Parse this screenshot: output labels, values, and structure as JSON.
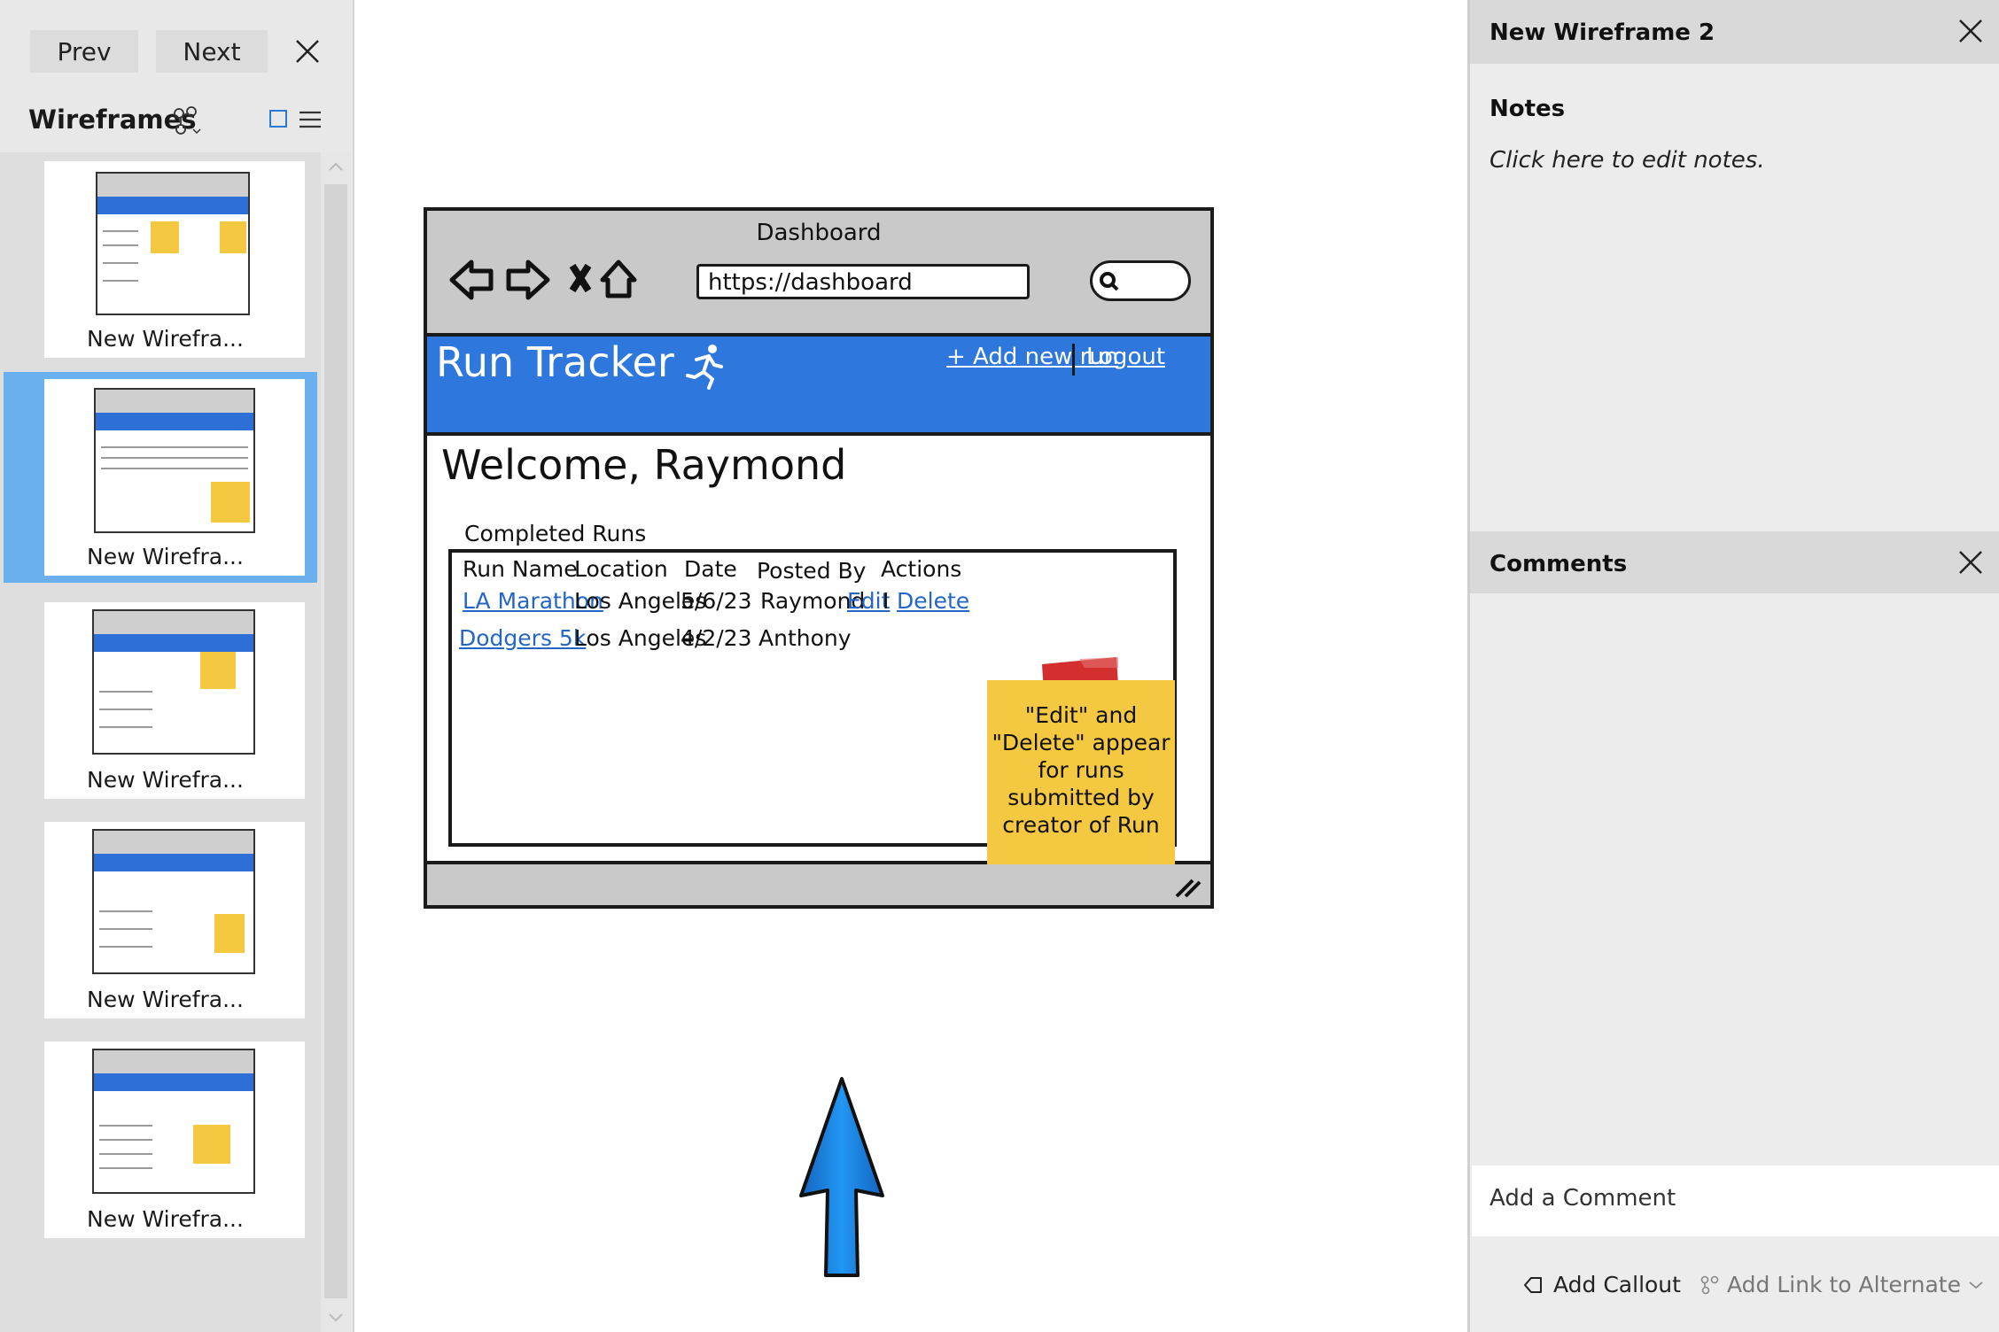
{
  "left_panel": {
    "prev_label": "Prev",
    "next_label": "Next",
    "title": "Wireframes",
    "thumbnails": [
      {
        "label": "New Wirefra...",
        "selected": false
      },
      {
        "label": "New Wirefra...",
        "selected": true
      },
      {
        "label": "New Wirefra...",
        "selected": false
      },
      {
        "label": "New Wirefra...",
        "selected": false
      },
      {
        "label": "New Wirefra...",
        "selected": false
      }
    ]
  },
  "mockup": {
    "browser_title": "Dashboard",
    "url": "https://dashboard",
    "app_name": "Run Tracker",
    "add_run_link": "+ Add new run",
    "logout_link": "Logout",
    "welcome": "Welcome, Raymond",
    "table_label": "Completed Runs",
    "columns": [
      "Run Name",
      "Location",
      "Date",
      "Posted By",
      "Actions"
    ],
    "rows": [
      {
        "name": "LA Marathon",
        "location": "Los Angeles",
        "date": "5/6/23",
        "posted_by": "Raymond",
        "edit": "Edit",
        "sep": "I",
        "delete": "Delete"
      },
      {
        "name": "Dodgers 5k",
        "location": "Los Angeles",
        "date": "4/2/23",
        "posted_by": "Anthony"
      }
    ],
    "sticky_note": "\"Edit\" and \"Delete\" appear for runs submitted by creator of Run",
    "colors": {
      "app_bar": "#2d77dd",
      "sticky": "#f5c842",
      "arrow": "#1e88e5"
    }
  },
  "right_panel": {
    "title": "New Wireframe 2",
    "notes_label": "Notes",
    "notes_hint": "Click here to edit notes.",
    "comments_label": "Comments",
    "add_comment_placeholder": "Add a Comment",
    "add_callout_label": "Add Callout",
    "add_link_label": "Add Link to Alternate"
  }
}
